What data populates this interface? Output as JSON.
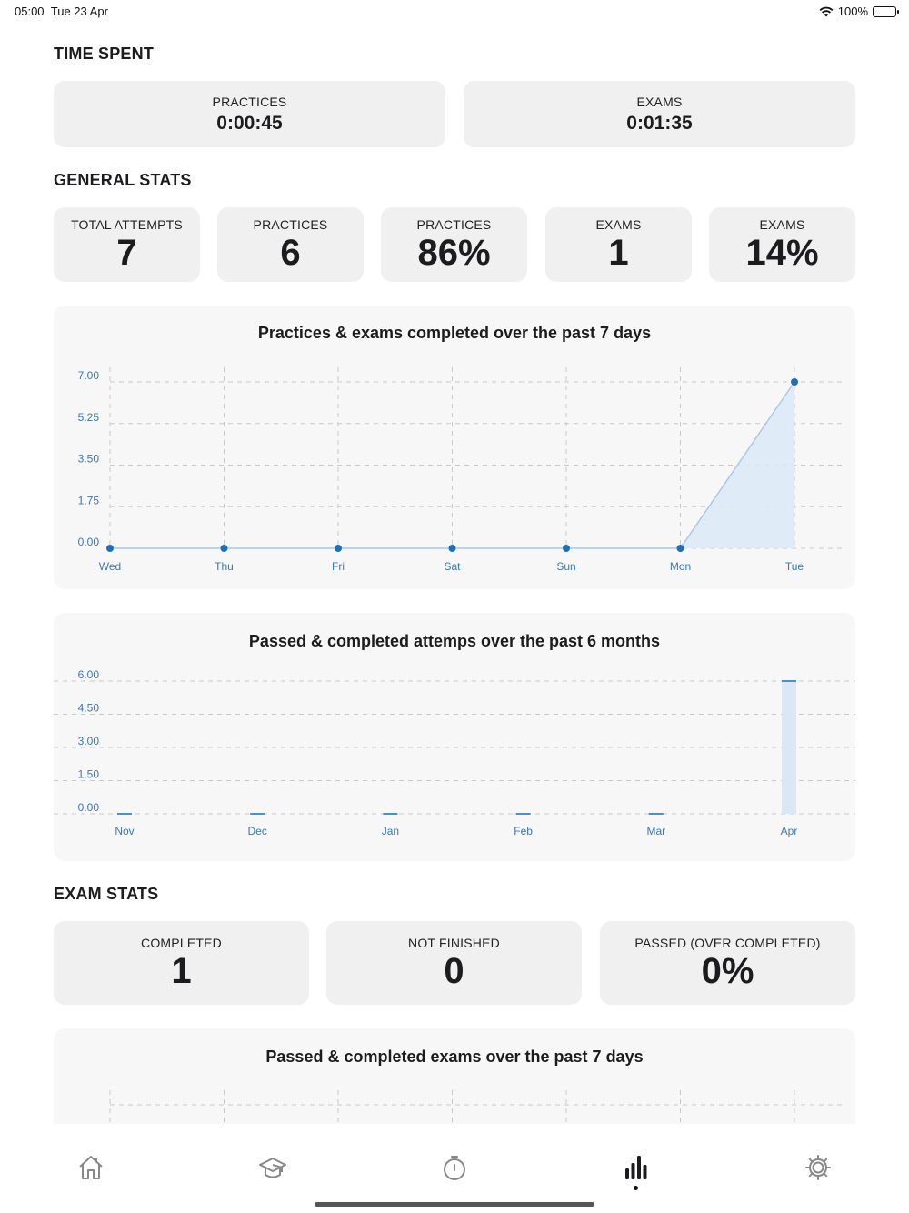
{
  "status_bar": {
    "time": "05:00",
    "date": "Tue 23 Apr",
    "battery": "100%"
  },
  "time_spent": {
    "title": "TIME SPENT",
    "practices_label": "PRACTICES",
    "practices_value": "0:00:45",
    "exams_label": "EXAMS",
    "exams_value": "0:01:35"
  },
  "general_stats": {
    "title": "GENERAL STATS",
    "cards": [
      {
        "label": "TOTAL ATTEMPTS",
        "value": "7"
      },
      {
        "label": "PRACTICES",
        "value": "6"
      },
      {
        "label": "PRACTICES",
        "value": "86%"
      },
      {
        "label": "EXAMS",
        "value": "1"
      },
      {
        "label": "EXAMS",
        "value": "14%"
      }
    ]
  },
  "chart_data": [
    {
      "type": "area",
      "title": "Practices & exams completed over the past 7 days",
      "categories": [
        "Wed",
        "Thu",
        "Fri",
        "Sat",
        "Sun",
        "Mon",
        "Tue"
      ],
      "values": [
        0,
        0,
        0,
        0,
        0,
        0,
        7
      ],
      "yticks": [
        "0.00",
        "1.75",
        "3.50",
        "5.25",
        "7.00"
      ],
      "ylim": [
        0,
        7
      ],
      "grid": true,
      "color": "#1e6fb8"
    },
    {
      "type": "bar",
      "title": "Passed & completed attemps over the past 6 months",
      "categories": [
        "Nov",
        "Dec",
        "Jan",
        "Feb",
        "Mar",
        "Apr"
      ],
      "values": [
        0,
        0,
        0,
        0,
        0,
        6
      ],
      "yticks": [
        "0.00",
        "1.50",
        "3.00",
        "4.50",
        "6.00"
      ],
      "ylim": [
        0,
        6
      ],
      "grid": true,
      "color": "#4a90d0"
    },
    {
      "type": "line",
      "title": "Passed & completed exams over the past 7 days",
      "grid": true
    }
  ],
  "exam_stats": {
    "title": "EXAM STATS",
    "cards": [
      {
        "label": "COMPLETED",
        "value": "1"
      },
      {
        "label": "NOT FINISHED",
        "value": "0"
      },
      {
        "label": "PASSED (OVER COMPLETED)",
        "value": "0%"
      }
    ]
  },
  "tab_bar": {
    "items": [
      "home-icon",
      "graduation-cap-icon",
      "stopwatch-icon",
      "bar-chart-icon",
      "gear-icon"
    ],
    "active": "bar-chart-icon"
  }
}
